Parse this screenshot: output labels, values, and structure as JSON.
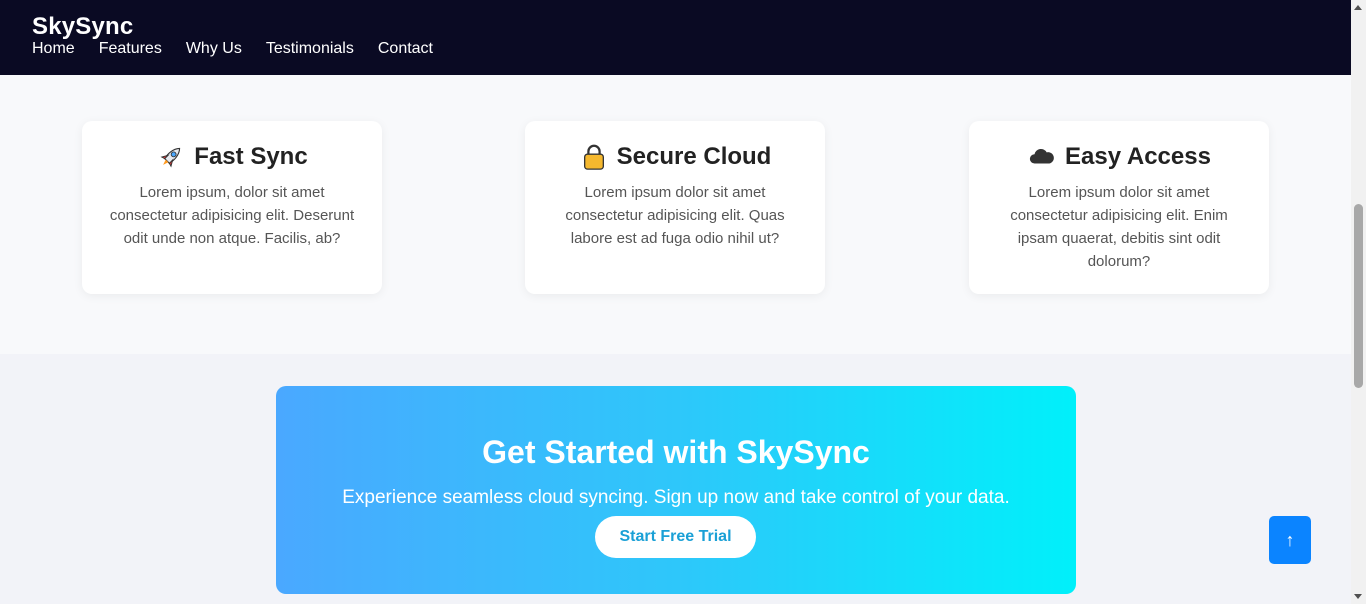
{
  "header": {
    "brand": "SkySync",
    "nav": [
      "Home",
      "Features",
      "Why Us",
      "Testimonials",
      "Contact"
    ]
  },
  "features": [
    {
      "icon": "rocket-icon",
      "title": "Fast Sync",
      "text": "Lorem ipsum, dolor sit amet consectetur adipisicing elit. Deserunt odit unde non atque. Facilis, ab?"
    },
    {
      "icon": "lock-icon",
      "title": "Secure Cloud",
      "text": "Lorem ipsum dolor sit amet consectetur adipisicing elit. Quas labore est ad fuga odio nihil ut?"
    },
    {
      "icon": "cloud-icon",
      "title": "Easy Access",
      "text": "Lorem ipsum dolor sit amet consectetur adipisicing elit. Enim ipsam quaerat, debitis sint odit dolorum?"
    }
  ],
  "cta": {
    "title": "Get Started with SkySync",
    "subtitle": "Experience seamless cloud syncing. Sign up now and take control of your data.",
    "button": "Start Free Trial"
  },
  "scroll_top": {
    "icon": "arrow-up-icon",
    "glyph": "↑"
  },
  "colors": {
    "nav_bg": "#0a0a23",
    "cta_gradient_start": "#4aa8ff",
    "cta_gradient_end": "#00f0fa",
    "scroll_top_bg": "#0b84ff"
  }
}
